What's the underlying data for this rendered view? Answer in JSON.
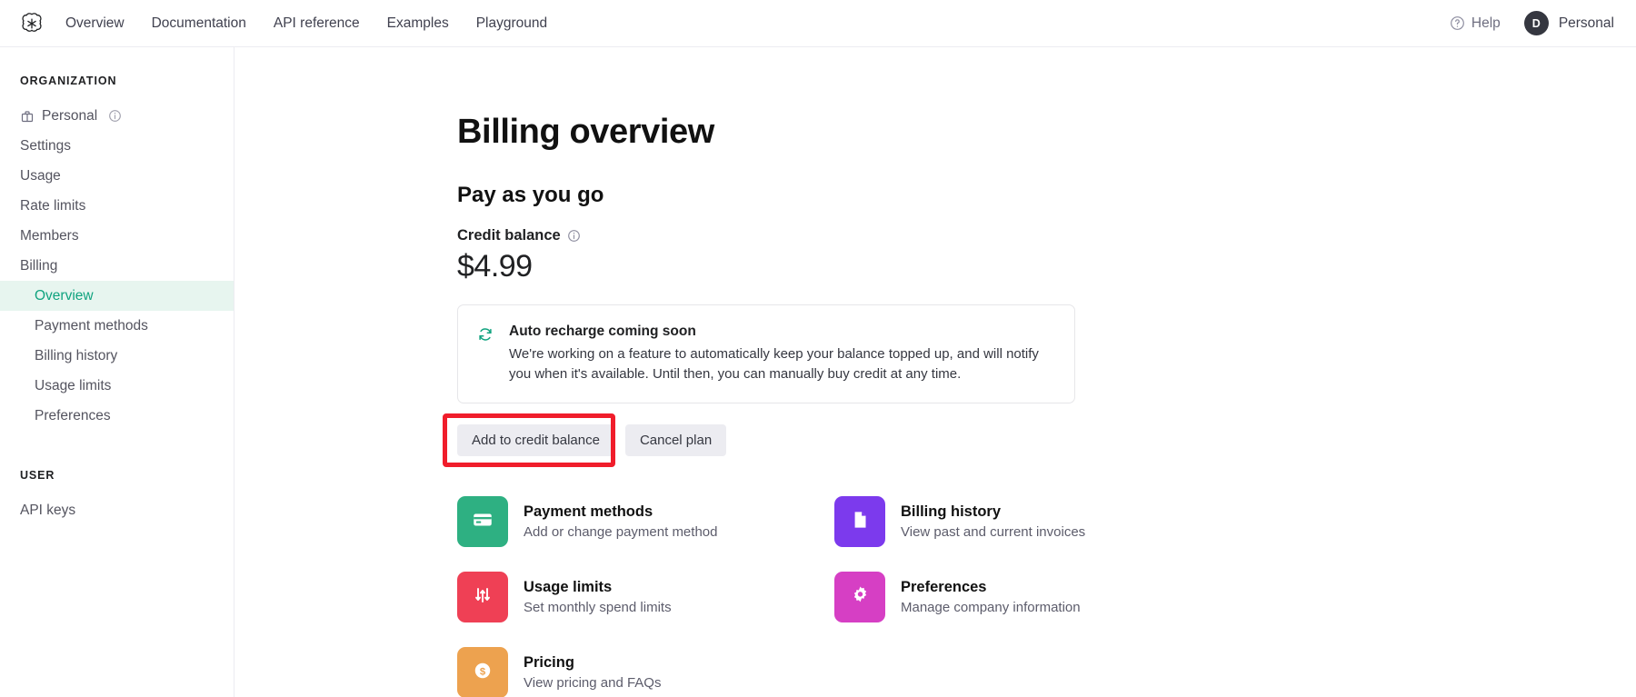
{
  "topbar": {
    "logo_icon": "openai-logo-icon",
    "nav": [
      {
        "label": "Overview"
      },
      {
        "label": "Documentation"
      },
      {
        "label": "API reference"
      },
      {
        "label": "Examples"
      },
      {
        "label": "Playground"
      }
    ],
    "help_label": "Help",
    "help_icon": "question-circle-icon",
    "avatar_initial": "D",
    "account_name": "Personal"
  },
  "sidebar": {
    "organization_title": "ORGANIZATION",
    "org_item": {
      "label": "Personal",
      "icon": "building-icon",
      "info_icon": "info-circle-icon"
    },
    "items": [
      {
        "label": "Settings"
      },
      {
        "label": "Usage"
      },
      {
        "label": "Rate limits"
      },
      {
        "label": "Members"
      },
      {
        "label": "Billing"
      }
    ],
    "billing_subitems": [
      {
        "label": "Overview",
        "active": true
      },
      {
        "label": "Payment methods",
        "active": false
      },
      {
        "label": "Billing history",
        "active": false
      },
      {
        "label": "Usage limits",
        "active": false
      },
      {
        "label": "Preferences",
        "active": false
      }
    ],
    "user_title": "USER",
    "user_items": [
      {
        "label": "API keys"
      }
    ],
    "active_color": "#10a37f",
    "active_bg": "#e7f5ef"
  },
  "main": {
    "page_title": "Billing overview",
    "section_title": "Pay as you go",
    "balance_label": "Credit balance",
    "balance_info_icon": "info-circle-icon",
    "balance_amount": "$4.99",
    "notice": {
      "icon": "refresh-cycle-icon",
      "title": "Auto recharge coming soon",
      "body": "We're working on a feature to automatically keep your balance topped up, and will notify you when it's available. Until then, you can manually buy credit at any time."
    },
    "buttons": {
      "primary_label": "Add to credit balance",
      "secondary_label": "Cancel plan",
      "highlight_color": "#f01d2b"
    },
    "tiles": [
      {
        "title": "Payment methods",
        "subtitle": "Add or change payment method",
        "icon": "credit-card-icon",
        "color": "#2eb082"
      },
      {
        "title": "Billing history",
        "subtitle": "View past and current invoices",
        "icon": "document-icon",
        "color": "#7c3aed"
      },
      {
        "title": "Usage limits",
        "subtitle": "Set monthly spend limits",
        "icon": "sliders-icon",
        "color": "#ef4055"
      },
      {
        "title": "Preferences",
        "subtitle": "Manage company information",
        "icon": "gear-icon",
        "color": "#d63fc4"
      },
      {
        "title": "Pricing",
        "subtitle": "View pricing and FAQs",
        "icon": "dollar-coin-icon",
        "color": "#eda košice"
      }
    ]
  }
}
